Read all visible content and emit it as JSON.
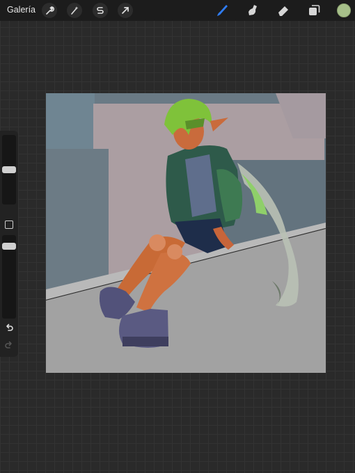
{
  "toolbar": {
    "gallery_label": "Galería",
    "left_icons": [
      "wrench-icon",
      "magic-wand-icon",
      "selection-s-icon",
      "transform-arrow-icon"
    ],
    "right_icons": [
      "brush-icon",
      "smudge-icon",
      "eraser-icon",
      "layers-icon"
    ],
    "active_tool": "brush",
    "current_color": "#a7c08a"
  },
  "sidebar": {
    "brush_size_level": 0.5,
    "opacity_level": 0.9,
    "undo_enabled": true,
    "redo_enabled": false
  },
  "colors": {
    "accent": "#2f7cf6",
    "background": "#2a2a2a"
  }
}
